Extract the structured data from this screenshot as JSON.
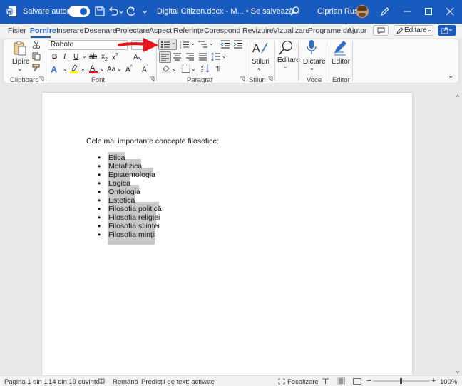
{
  "titlebar": {
    "autosave_label": "Salvare automată",
    "document_title": "Digital Citizen.docx - M... • Se salvează...",
    "user_name": "Ciprian Rusen"
  },
  "menu": {
    "tabs": [
      "Fișier",
      "Pornire",
      "Inserare",
      "Desenare",
      "Proiectare",
      "Aspect",
      "Referințe",
      "Corespondențe",
      "Revizuire",
      "Vizualizare",
      "Programe de",
      "Ajutor"
    ],
    "active_tab": "Pornire",
    "edit_mode_label": "Editare"
  },
  "ribbon": {
    "paste_label": "Lipire",
    "font_name": "Roboto",
    "styles_label": "Stiluri",
    "editing_label": "Editare",
    "dictate_label": "Dictare",
    "editor_label": "Editor",
    "groups": {
      "clipboard": "Clipboard",
      "font": "Font",
      "paragraph": "Paragraf",
      "styles": "Stiluri",
      "voice": "Voce",
      "editor": "Editor"
    }
  },
  "document": {
    "heading": "Cele mai importante concepte filosofice:",
    "items": [
      "Etica",
      "Metafizica",
      "Epistemologia",
      "Logica",
      "Ontologia",
      "Estetica",
      "Filosofia politică",
      "Filosofia religiei",
      "Filosofia științei",
      "Filosofia minții"
    ]
  },
  "statusbar": {
    "page": "Pagina 1 din 1",
    "words": "14 din 19 cuvinte",
    "language": "Română",
    "predictions": "Predicții de text: activate",
    "focus": "Focalizare",
    "zoom": "100%"
  },
  "colors": {
    "accent": "#185abd",
    "highlight": "#ffff00",
    "font_color": "#e81123",
    "annotation_arrow": "#e8141c"
  }
}
